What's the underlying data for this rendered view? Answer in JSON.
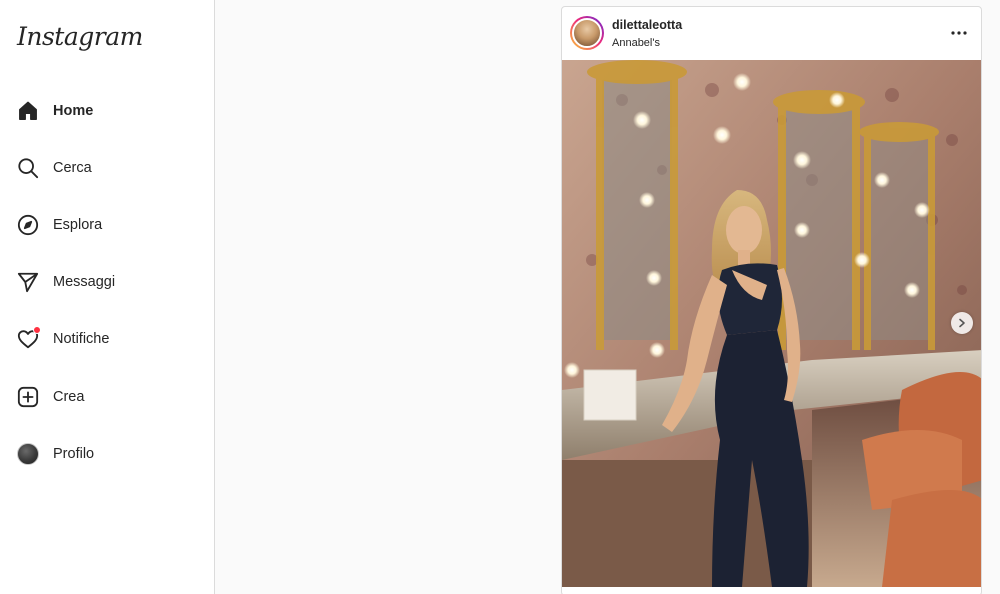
{
  "app": {
    "logo_text": "Instagram"
  },
  "sidebar": {
    "items": [
      {
        "label": "Home",
        "icon": "home-icon",
        "active": true
      },
      {
        "label": "Cerca",
        "icon": "search-icon"
      },
      {
        "label": "Esplora",
        "icon": "compass-icon"
      },
      {
        "label": "Messaggi",
        "icon": "send-icon"
      },
      {
        "label": "Notifiche",
        "icon": "heart-icon",
        "has_notification_dot": true
      },
      {
        "label": "Crea",
        "icon": "plus-square-icon"
      },
      {
        "label": "Profilo",
        "icon": "avatar"
      }
    ]
  },
  "post": {
    "username": "dilettaleotta",
    "location": "Annabel's",
    "more_icon": "more-horizontal-icon",
    "next_icon": "chevron-right-icon",
    "image_description_icon": "photo"
  },
  "colors": {
    "notification_dot": "#ff3040",
    "text": "#262626",
    "border": "#dbdbdb",
    "feed_background": "#fafafa"
  }
}
